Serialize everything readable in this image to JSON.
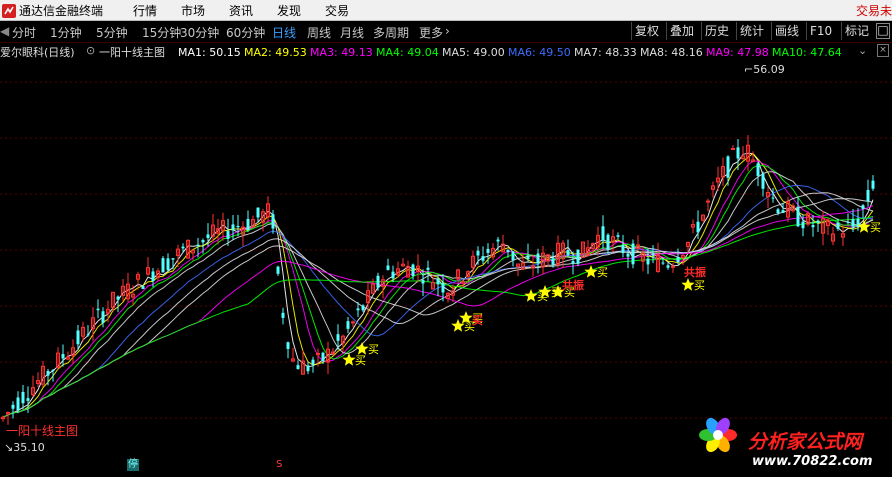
{
  "menubar": {
    "app_title": "通达信金融终端",
    "items": [
      "行情",
      "市场",
      "资讯",
      "发现",
      "交易"
    ],
    "trade_link": "交易未"
  },
  "periods": [
    "分时",
    "1分钟",
    "5分钟",
    "15分钟",
    "30分钟",
    "60分钟",
    "日线",
    "周线",
    "月线",
    "多周期",
    "更多"
  ],
  "active_period": "日线",
  "right_tools": [
    "复权",
    "叠加",
    "历史",
    "统计",
    "画线",
    "F10",
    "标记"
  ],
  "indicator": {
    "stock": "爱尔眼科(日线)",
    "formula": "一阳十线主图",
    "ma": [
      {
        "label": "MA1:",
        "value": "50.15",
        "color": "#ffffff"
      },
      {
        "label": "MA2:",
        "value": "49.53",
        "color": "#ffff00"
      },
      {
        "label": "MA3:",
        "value": "49.13",
        "color": "#ff00ff"
      },
      {
        "label": "MA4:",
        "value": "49.04",
        "color": "#00ff00"
      },
      {
        "label": "MA5:",
        "value": "49.00",
        "color": "#dddddd"
      },
      {
        "label": "MA6:",
        "value": "49.50",
        "color": "#3c6cff"
      },
      {
        "label": "MA7:",
        "value": "48.33",
        "color": "#dddddd"
      },
      {
        "label": "MA8:",
        "value": "48.16",
        "color": "#dddddd"
      },
      {
        "label": "MA9:",
        "value": "47.98",
        "color": "#ff00ff"
      },
      {
        "label": "MA10:",
        "value": "47.64",
        "color": "#00ff00"
      }
    ]
  },
  "price_high": "56.09",
  "price_low": "35.10",
  "chart_caption": "一阳十线主图",
  "buy_label": "买",
  "signal_label": "共振",
  "bottom_marks": [
    "停",
    "S"
  ],
  "watermark": {
    "title": "分析家公式网",
    "url": "www.70822.com"
  },
  "colors": {
    "up": "#ff3232",
    "down": "#54ffff",
    "grid": "#5a0000"
  }
}
